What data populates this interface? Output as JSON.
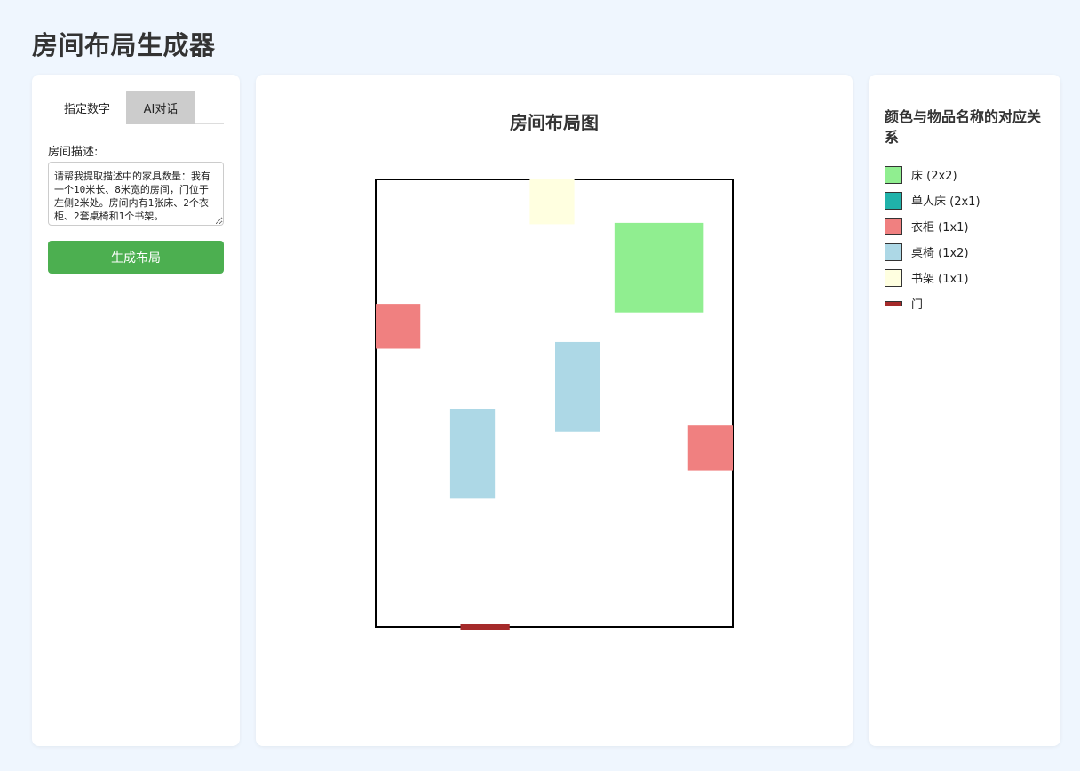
{
  "app": {
    "title": "房间布局生成器"
  },
  "left": {
    "tabs": [
      {
        "label": "指定数字",
        "active": true
      },
      {
        "label": "AI对话",
        "active": false
      }
    ],
    "description_label": "房间描述:",
    "description_value": "请帮我提取描述中的家具数量：我有一个10米长、8米宽的房间，门位于左侧2米处。房间内有1张床、2个衣柜、2套桌椅和1个书架。",
    "generate_label": "生成布局"
  },
  "center": {
    "title": "房间布局图"
  },
  "legend": {
    "title": "颜色与物品名称的对应关系",
    "items": [
      {
        "label": "床 (2x2)",
        "color": "#90ee90",
        "kind": "bed"
      },
      {
        "label": "单人床 (2x1)",
        "color": "#20b2aa",
        "kind": "single-bed"
      },
      {
        "label": "衣柜 (1x1)",
        "color": "#f08080",
        "kind": "wardrobe"
      },
      {
        "label": "桌椅 (1x2)",
        "color": "#add8e6",
        "kind": "desk"
      },
      {
        "label": "书架 (1x1)",
        "color": "#ffffe0",
        "kind": "bookshelf"
      },
      {
        "label": "门",
        "color": "#a52a2a",
        "kind": "door"
      }
    ]
  },
  "room": {
    "width_m": 8,
    "length_m": 10,
    "wall_color": "#000000",
    "door": {
      "x": 1.9,
      "length": 1.1,
      "wall": "bottom",
      "color": "#a52a2a"
    },
    "furniture": [
      {
        "kind": "bookshelf",
        "x": 3.45,
        "y": 0,
        "w": 1,
        "h": 1,
        "color": "#ffffe0"
      },
      {
        "kind": "bed",
        "x": 5.35,
        "y": 0.97,
        "w": 2,
        "h": 2,
        "color": "#90ee90"
      },
      {
        "kind": "wardrobe",
        "x": 0,
        "y": 2.78,
        "w": 1,
        "h": 1,
        "color": "#f08080"
      },
      {
        "kind": "desk",
        "x": 4.02,
        "y": 3.63,
        "w": 1,
        "h": 2,
        "color": "#add8e6"
      },
      {
        "kind": "desk",
        "x": 1.67,
        "y": 5.13,
        "w": 1,
        "h": 2,
        "color": "#add8e6"
      },
      {
        "kind": "wardrobe",
        "x": 7,
        "y": 5.5,
        "w": 1,
        "h": 1,
        "color": "#f08080"
      }
    ]
  }
}
